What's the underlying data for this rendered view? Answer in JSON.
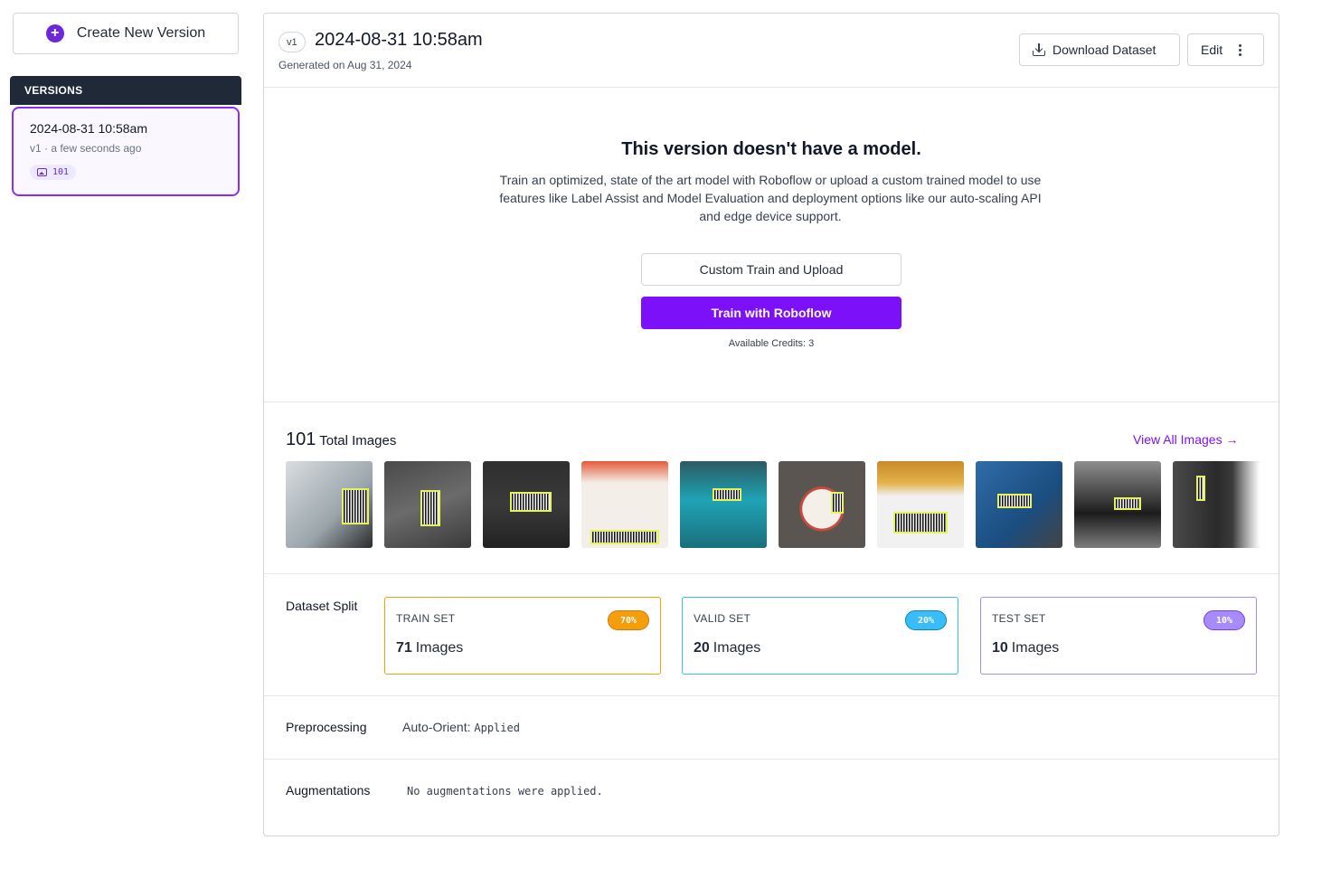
{
  "sidebar": {
    "create_label": "Create New Version",
    "versions_header": "VERSIONS",
    "version_item": {
      "title": "2024-08-31 10:58am",
      "subtitle": "v1 · a few seconds ago",
      "badge": "101"
    }
  },
  "header": {
    "version_tag": "v1",
    "title": "2024-08-31 10:58am",
    "generated": "Generated on Aug 31, 2024",
    "download_label": "Download Dataset",
    "edit_label": "Edit"
  },
  "no_model": {
    "title": "This version doesn't have a model.",
    "description": "Train an optimized, state of the art model with Roboflow or upload a custom trained model to use features like Label Assist and Model Evaluation and deployment options like our auto-scaling API and edge device support.",
    "custom_train_label": "Custom Train and Upload",
    "train_label": "Train with Roboflow",
    "credits_label": "Available Credits:",
    "credits_value": "3"
  },
  "images": {
    "total_count": "101",
    "total_label": "Total Images",
    "view_all_label": "View All Images →"
  },
  "split": {
    "label": "Dataset Split",
    "train": {
      "title": "TRAIN SET",
      "percent": "70%",
      "count": "71",
      "unit": "Images",
      "color": "#f59e0b"
    },
    "valid": {
      "title": "VALID SET",
      "percent": "20%",
      "count": "20",
      "unit": "Images",
      "color": "#38bdf8"
    },
    "test": {
      "title": "TEST SET",
      "percent": "10%",
      "count": "10",
      "unit": "Images",
      "color": "#a78bfa"
    }
  },
  "preprocessing": {
    "label": "Preprocessing",
    "step_name": "Auto-Orient:",
    "step_value": "Applied"
  },
  "augmentations": {
    "label": "Augmentations",
    "value": "No augmentations were applied."
  },
  "colors": {
    "accent": "#7c10f8",
    "sidebar_header": "#1f2937"
  }
}
